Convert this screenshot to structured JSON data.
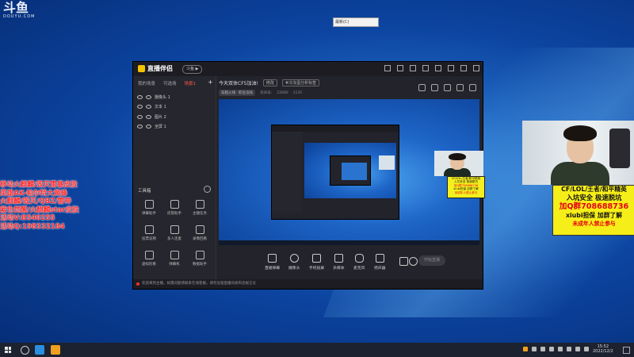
{
  "watermark": {
    "logo_text": "斗鱼",
    "sub_text": "DOUYU.COM"
  },
  "mini_window": {
    "label": "最新(C)"
  },
  "overlay_lines": [
    "移动火麒麟/毁灭雷暴皮肤",
    "英雄AK-帕尔特大黄蜂",
    "火麒麟/毁灭/QBZ/雷神",
    "紫色觉醒/火麒麟star皮肤",
    "活动V:B540255",
    "活动Q:198332184"
  ],
  "app": {
    "logo_text": "直播伴侣",
    "version_pill": "斗鱼 ▶",
    "tabs": [
      "我的场景",
      "可选场",
      "场景1"
    ],
    "tab_plus": "+",
    "scenes": [
      {
        "label": "摄像头 1"
      },
      {
        "label": "文本 1"
      },
      {
        "label": "图片 2"
      },
      {
        "label": "全屏 1"
      }
    ],
    "tools_title": "工具箱",
    "tools": [
      {
        "label": "弹幕助手"
      },
      {
        "label": "房管助手"
      },
      {
        "label": "主播任务"
      },
      {
        "label": "投票竞猜"
      },
      {
        "label": "多人连麦"
      },
      {
        "label": "录像回看"
      },
      {
        "label": "虚拟形象"
      },
      {
        "label": "弹幕机"
      },
      {
        "label": "数据助手"
      }
    ],
    "stream_title": "今天双体CF5加油!",
    "stream_title_pill1": "修改",
    "stream_title_pill2": "#冷冻蛋分析标签",
    "meta": {
      "category_pill": "穿越火线 · 职业竞技",
      "room_label": "房间号:",
      "count1": "22680",
      "count2": "1135"
    },
    "controls": [
      {
        "label": "直播弹幕"
      },
      {
        "label": "摄像头"
      },
      {
        "label": "手机投屏"
      },
      {
        "label": "多媒体"
      },
      {
        "label": "麦克风"
      },
      {
        "label": "扬声器"
      }
    ],
    "live_button": "开始直播",
    "status_text": "欢迎来到主播，如遇问题请联系在线客服，请勿逗留直播间发布违规言论"
  },
  "promo_small": {
    "lines": [
      "CF/LOL/王者/和平精英",
      "入坑安全 极速脱坑",
      "加Q群708688736",
      "xiubi担保 加群了解",
      "未成年人禁止参与"
    ]
  },
  "promo_big": {
    "line1": "CF/LOL/王者/和平精英",
    "line2": "入坑安全 极速脱坑",
    "line3": "加Q群708688736",
    "line4": "xiubi担保 加群了解",
    "line5": "未成年人禁止参与"
  },
  "taskbar": {
    "time": "15:52",
    "date": "2022/12/2"
  },
  "colors": {
    "overlay_red": "#ff2a2a",
    "promo_yellow": "#f6ee18",
    "promo_red": "#e60012",
    "app_bg": "#23232b"
  }
}
